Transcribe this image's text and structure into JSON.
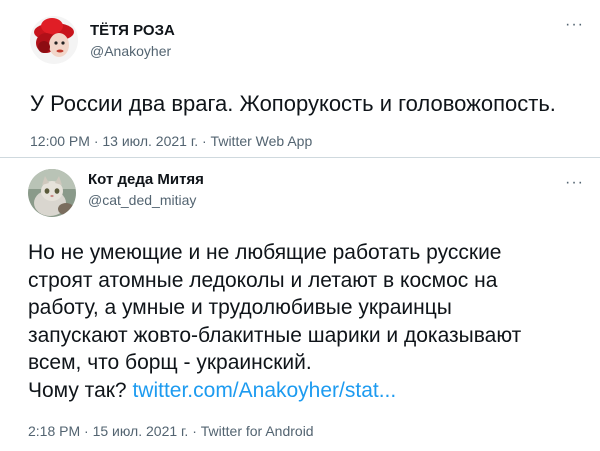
{
  "tweets": [
    {
      "display_name": "ТЁТЯ РОЗА",
      "handle": "@Anakoyher",
      "text_lines": [
        "У России два врага. Жопорукость и головожопость."
      ],
      "timestamp": "12:00 PM · 13 июл. 2021 г. · Twitter Web App",
      "more_label": "···",
      "avatar_icon": "red-hat-woman-avatar"
    },
    {
      "display_name": "Кот деда Митяя",
      "handle": "@cat_ded_mitiay",
      "text_lines": [
        "Но не умеющие и не любящие работать русские",
        "строят атомные ледоколы и летают в космос на",
        "работу, а умные и трудолюбивые украинцы",
        "запускают жовто-блакитные шарики и доказывают",
        "всем, что борщ - украинский."
      ],
      "last_line_prefix": "Чому так? ",
      "link_text": "twitter.com/Anakoyher/stat...",
      "timestamp": "2:18 PM · 15 июл. 2021 г. · Twitter for Android",
      "more_label": "···",
      "avatar_icon": "cat-photo-avatar"
    }
  ],
  "colors": {
    "text": "#0f1419",
    "secondary": "#536471",
    "link": "#1d9bf0",
    "divider": "#cfd9de"
  }
}
